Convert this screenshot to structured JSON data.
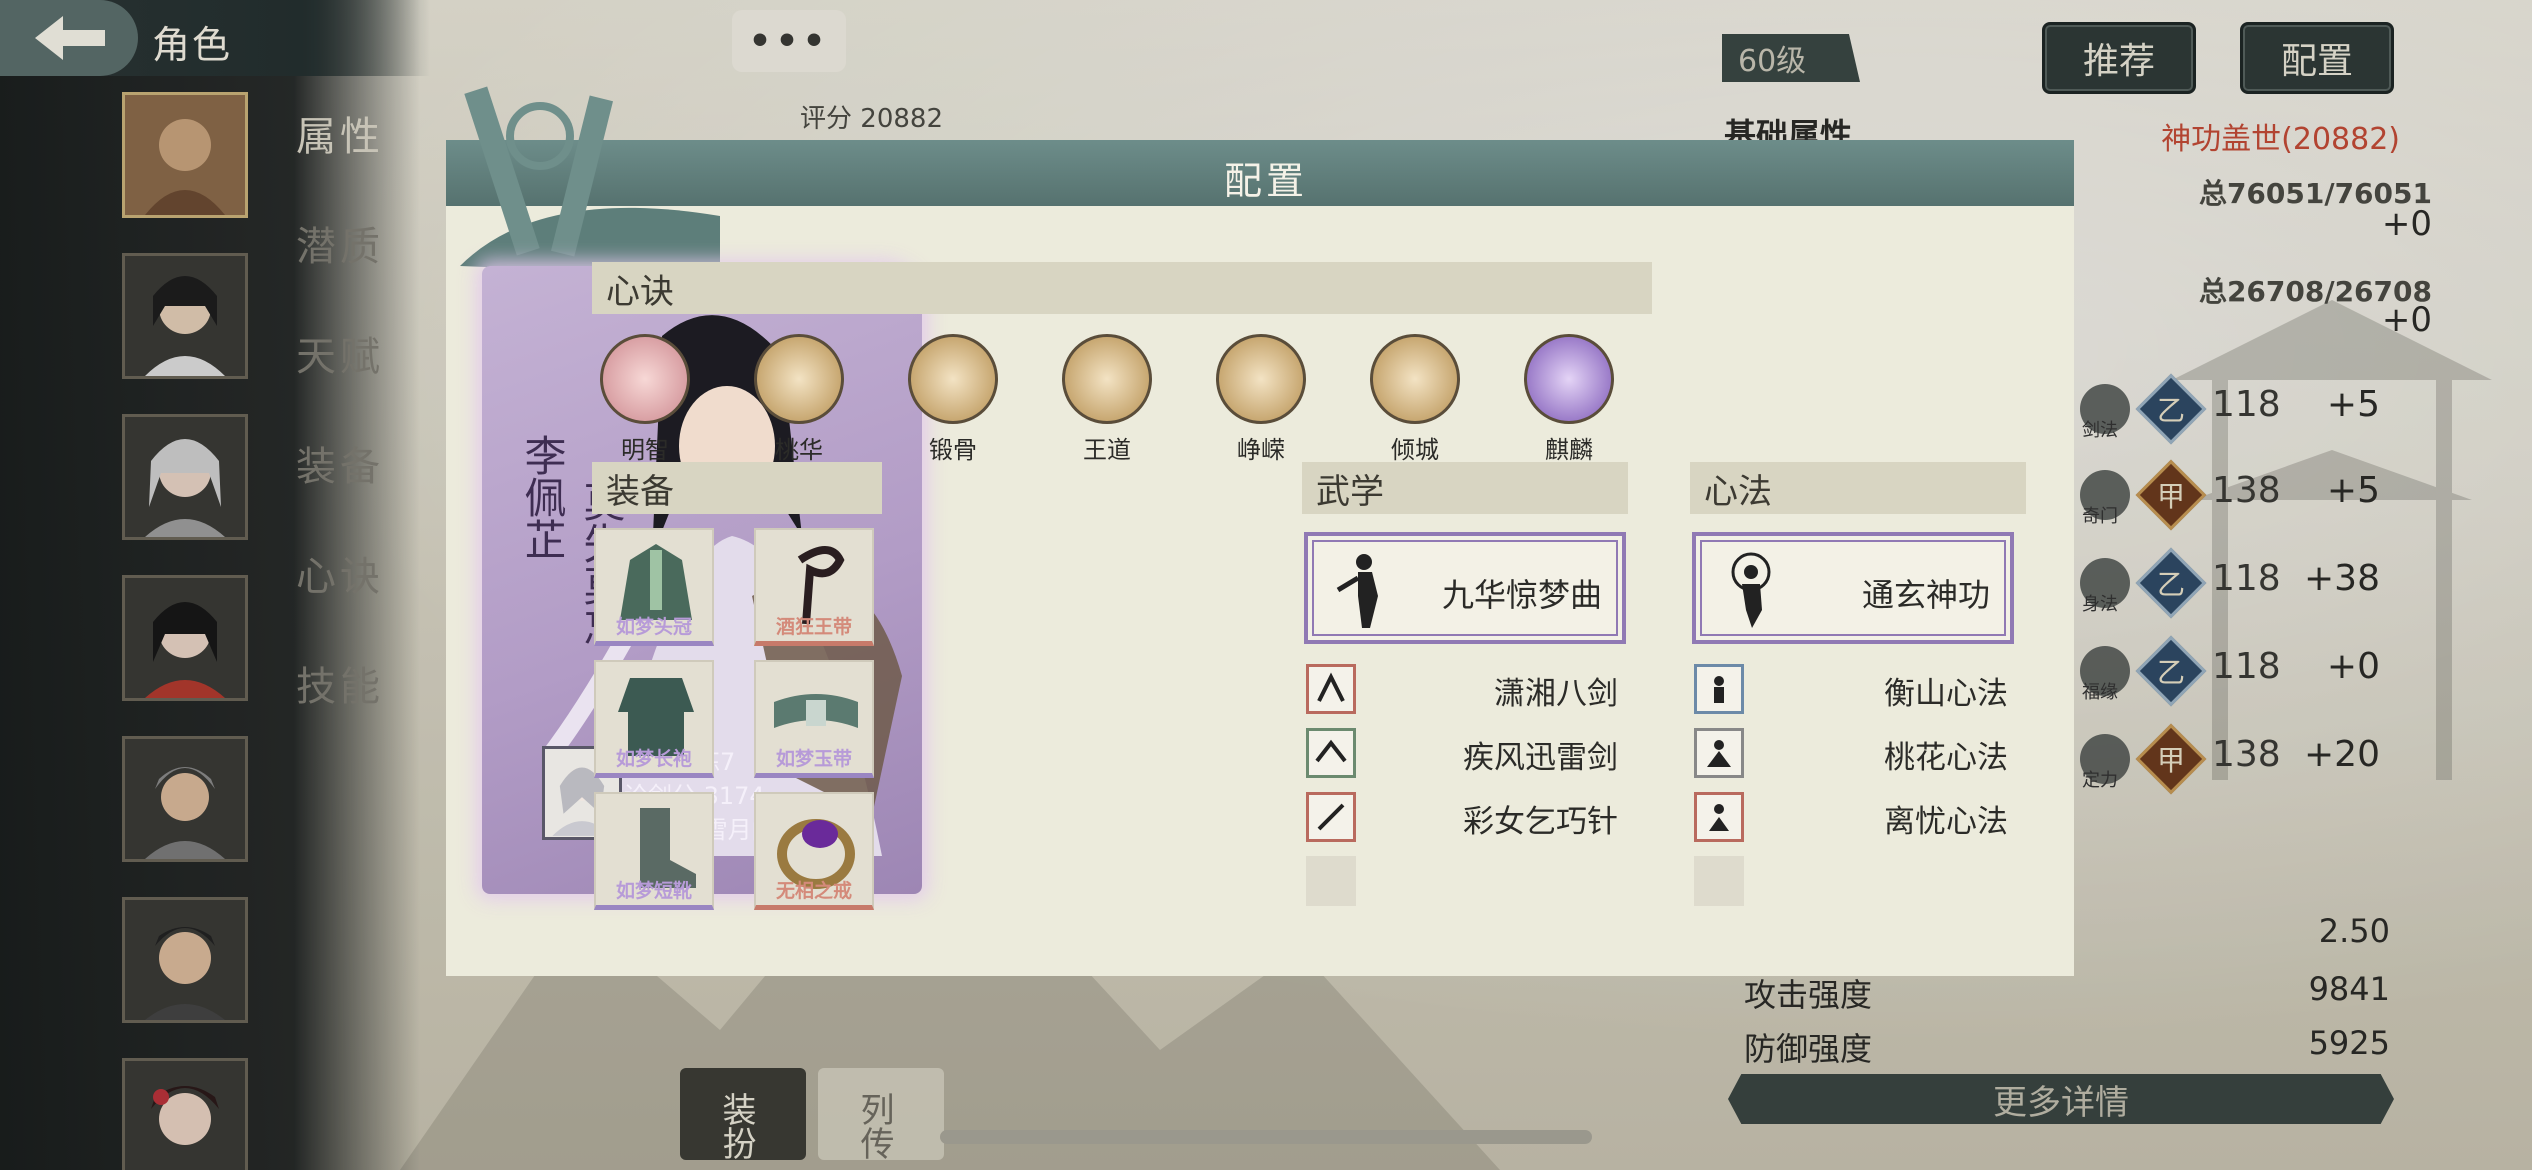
{
  "header": {
    "title": "角色",
    "chat_label": "•••",
    "level": "60级",
    "recommend_label": "推荐",
    "config_label": "配置"
  },
  "score_bg": {
    "label": "评分",
    "value": "20882"
  },
  "nav": [
    "属性",
    "潜质",
    "天赋",
    "装备",
    "心诀",
    "技能"
  ],
  "stats": {
    "title": "基础属性",
    "subtitle": "神功盖世(20882)",
    "hp_total": "总76051/76051",
    "hp_plus": "+0",
    "mp_total": "总26708/26708",
    "mp_plus": "+0",
    "attributes": [
      {
        "icon": "剑法",
        "grade": "乙",
        "value": "118",
        "bonus": "+5"
      },
      {
        "icon": "奇门",
        "grade": "甲",
        "value": "138",
        "bonus": "+5"
      },
      {
        "icon": "身法",
        "grade": "乙",
        "value": "118",
        "bonus": "+38"
      },
      {
        "icon": "福缘",
        "grade": "乙",
        "value": "118",
        "bonus": "+0"
      },
      {
        "icon": "定力",
        "grade": "甲",
        "value": "138",
        "bonus": "+20"
      }
    ],
    "lower": [
      {
        "label": "",
        "value": "2.50"
      },
      {
        "label": "攻击强度",
        "value": "9841"
      },
      {
        "label": "防御强度",
        "value": "5925"
      }
    ],
    "more_label": "更多详情"
  },
  "bottom_tabs": {
    "dress": "装扮",
    "bio": "列传"
  },
  "modal": {
    "title": "配置",
    "character": {
      "name": "李佩芷",
      "title": "莫失莫忘"
    },
    "player": {
      "line1": "拳击教练7",
      "line2": "论剑分 3174",
      "line3": "帮　会 雪月阁(雪)"
    },
    "xinjue_header": "心诀",
    "xinjue": [
      "明智",
      "桃华",
      "锻骨",
      "王道",
      "峥嵘",
      "倾城",
      "麒麟"
    ],
    "equip_header": "装备",
    "equipment": [
      "如梦头冠",
      "酒狂王带",
      "如梦长袍",
      "如梦玉带",
      "如梦短靴",
      "无相之戒"
    ],
    "wuxue_header": "武学",
    "wuxue_main": "九华惊梦曲",
    "wuxue_list": [
      "潇湘八剑",
      "疾风迅雷剑",
      "彩女乞巧针"
    ],
    "xinfa_header": "心法",
    "xinfa_main": "通玄神功",
    "xinfa_list": [
      "衡山心法",
      "桃花心法",
      "离忧心法"
    ]
  },
  "colors": {
    "accent_purple": "#9079b4",
    "header_teal": "#6d8d8a",
    "red_text": "#c24a36"
  }
}
